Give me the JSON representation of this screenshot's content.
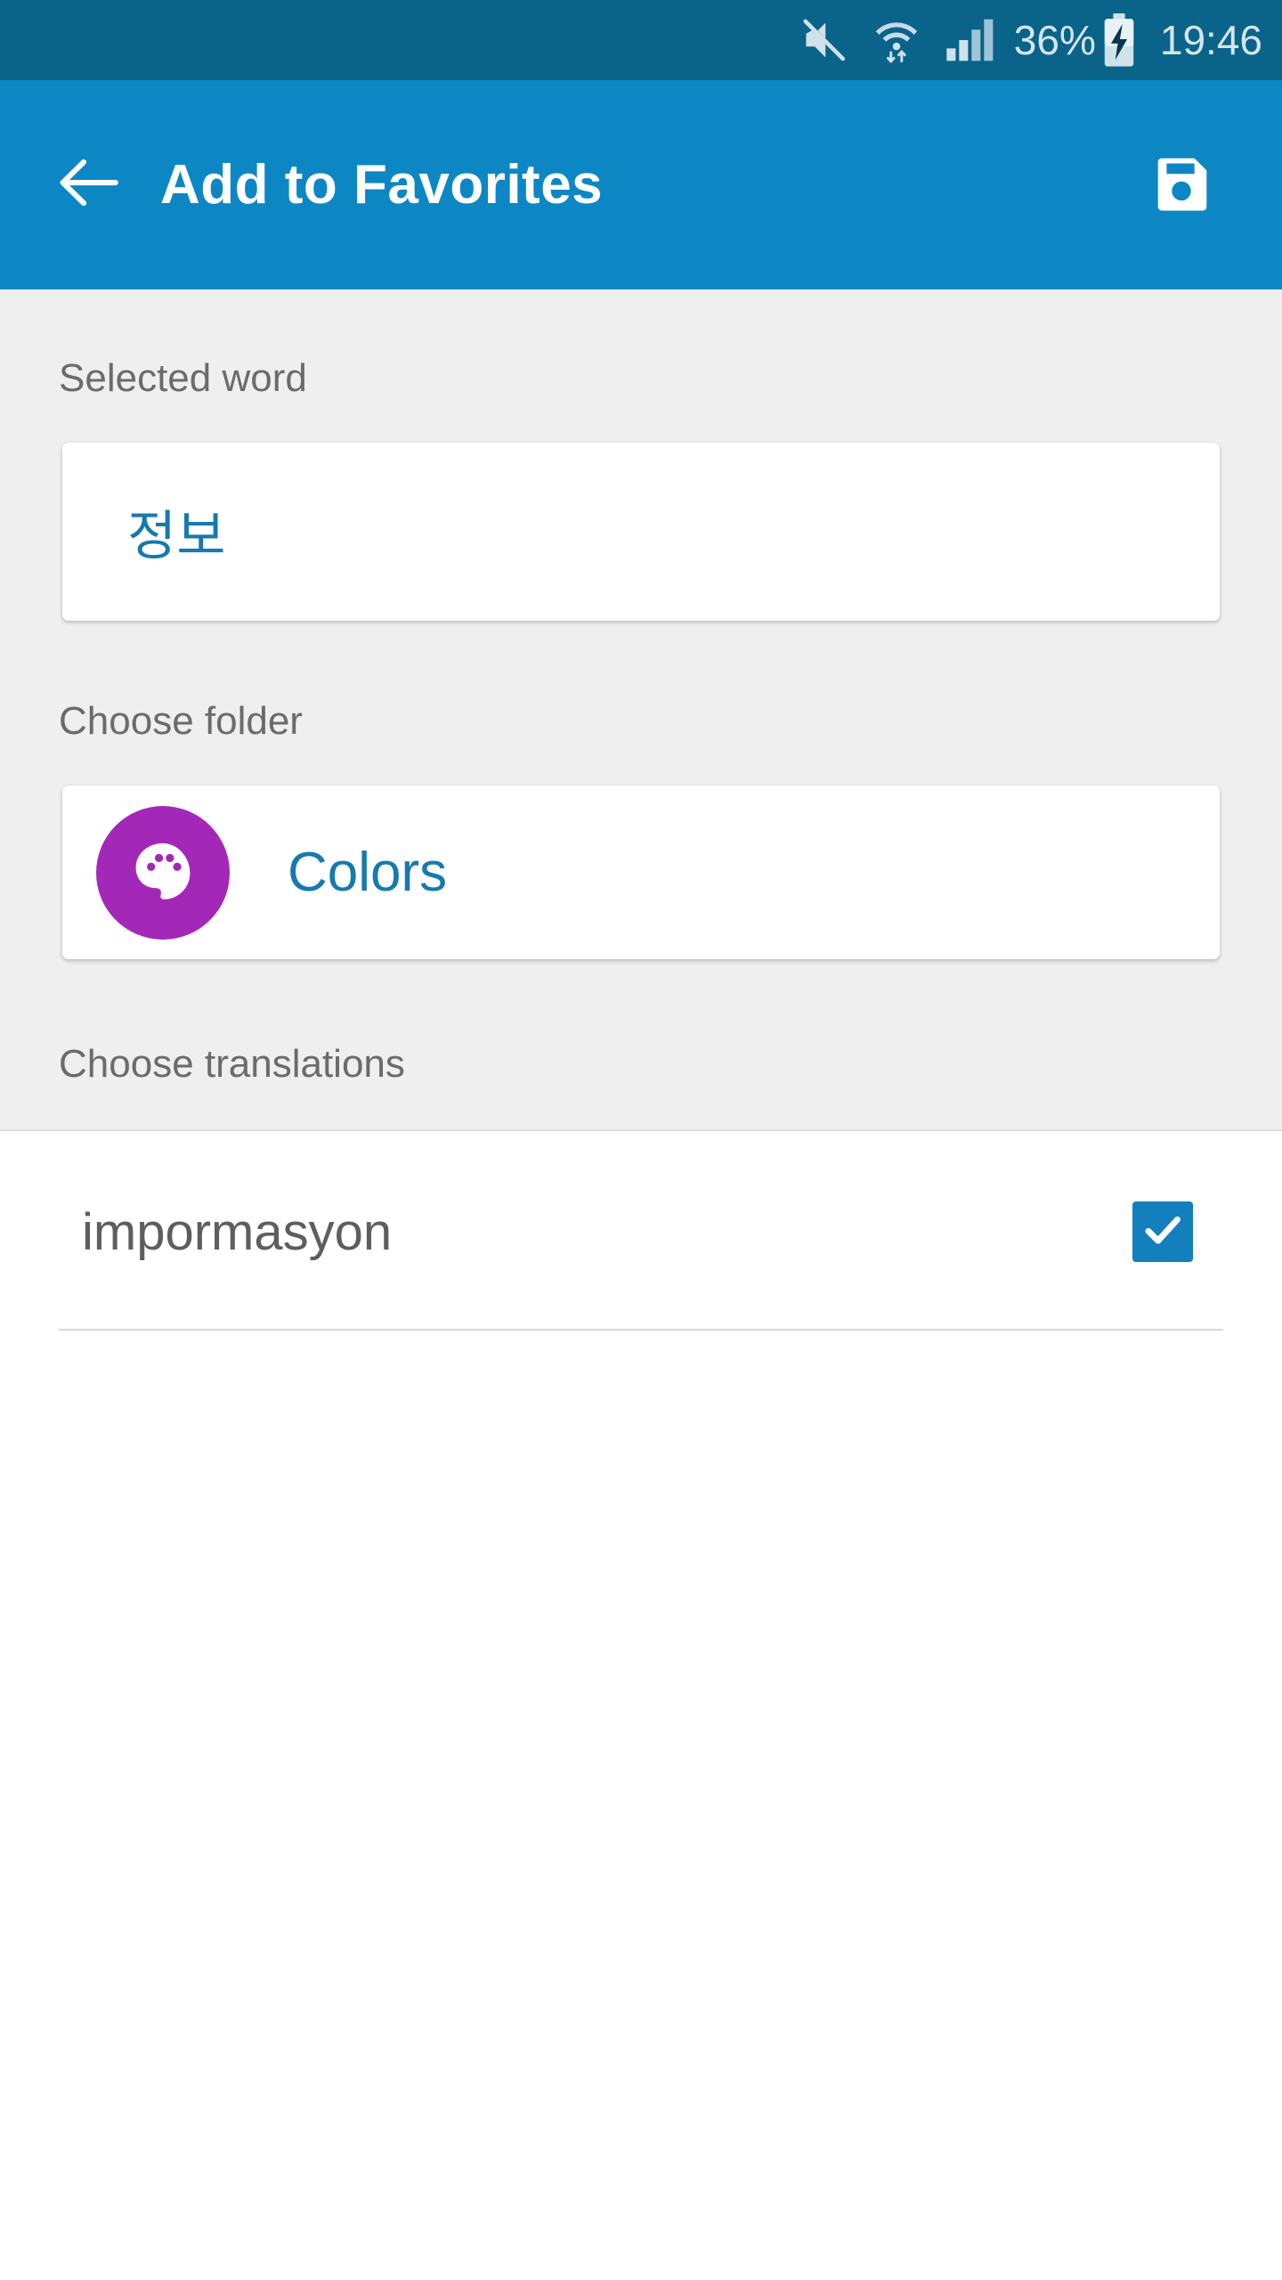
{
  "status_bar": {
    "battery_percent": "36%",
    "clock": "19:46",
    "icons": [
      "volume-off-icon",
      "wifi-icon",
      "signal-bars-icon",
      "battery-charging-icon"
    ],
    "background_color": "#0a6389",
    "text_color": "#d5e5ee"
  },
  "app_bar": {
    "title": "Add to Favorites",
    "back_icon": "arrow-left-icon",
    "save_icon": "save-floppy-icon",
    "background_color": "#0d87c4"
  },
  "body": {
    "selected_word": {
      "label": "Selected word",
      "value": "정보",
      "value_color": "#1779b0"
    },
    "choose_folder": {
      "label": "Choose folder",
      "folder_name": "Colors",
      "folder_icon": "palette-icon",
      "avatar_color": "#a328b8",
      "name_color": "#1779b0"
    },
    "choose_translations": {
      "label": "Choose translations",
      "items": [
        {
          "text": "impormasyon",
          "checked": true
        }
      ],
      "checkbox_color": "#1380bd"
    }
  }
}
